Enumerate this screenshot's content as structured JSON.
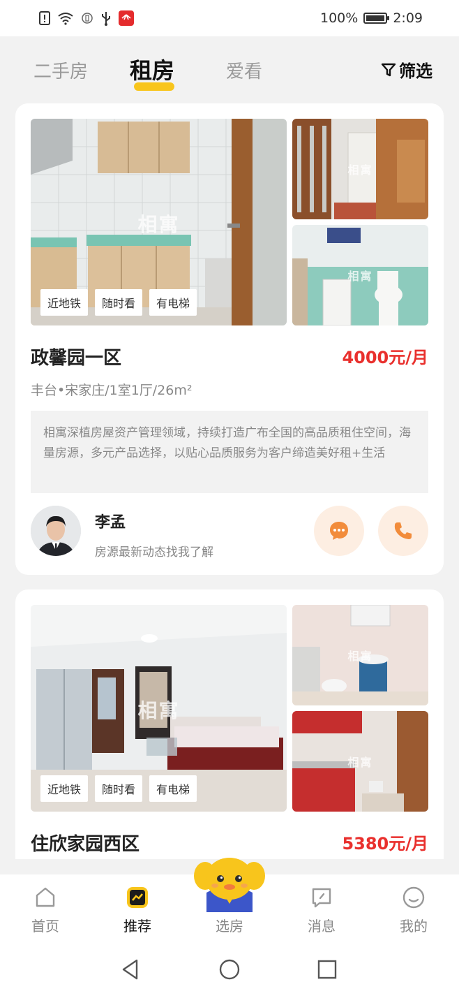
{
  "status_bar": {
    "battery": "100%",
    "battery_level": 1.0,
    "time": "2:09",
    "icons": [
      "alert-icon",
      "wifi-icon",
      "nfc-icon",
      "usb-icon",
      "huawei-app-icon"
    ]
  },
  "top_tabs": {
    "tabs": [
      {
        "label": "二手房",
        "active": false
      },
      {
        "label": "租房",
        "active": true
      },
      {
        "label": "爱看",
        "active": false
      }
    ],
    "filter_label": "筛选",
    "accent": "#f8c51c"
  },
  "listings": [
    {
      "watermark": "相寓",
      "tags": [
        "近地铁",
        "随时看",
        "有电梯"
      ],
      "title": "政馨园一区",
      "price": "4000元/月",
      "meta": "丰台•宋家庄/1室1厅/26m²",
      "description": "相寓深植房屋资产管理领域，持续打造广布全国的高品质租住空间，海量房源，多元产品选择，以贴心品质服务为客户缔造美好租+生活",
      "agent": {
        "name": "李孟",
        "note": "房源最新动态找我了解"
      }
    },
    {
      "watermark": "相寓",
      "tags": [
        "近地铁",
        "随时看",
        "有电梯"
      ],
      "title": "住欣家园西区",
      "price": "5380元/月"
    }
  ],
  "bottom_nav": {
    "items": [
      {
        "label": "首页",
        "icon": "home-icon",
        "active": false
      },
      {
        "label": "推荐",
        "icon": "trend-icon",
        "active": true
      },
      {
        "label": "选房",
        "icon": "mascot-icon",
        "active": false
      },
      {
        "label": "消息",
        "icon": "message-icon",
        "active": false
      },
      {
        "label": "我的",
        "icon": "profile-icon",
        "active": false
      }
    ]
  },
  "colors": {
    "price": "#e9302d",
    "accent_yellow": "#f8c51c",
    "action_button_bg": "#fdeee2",
    "action_icon": "#f28c3b"
  }
}
